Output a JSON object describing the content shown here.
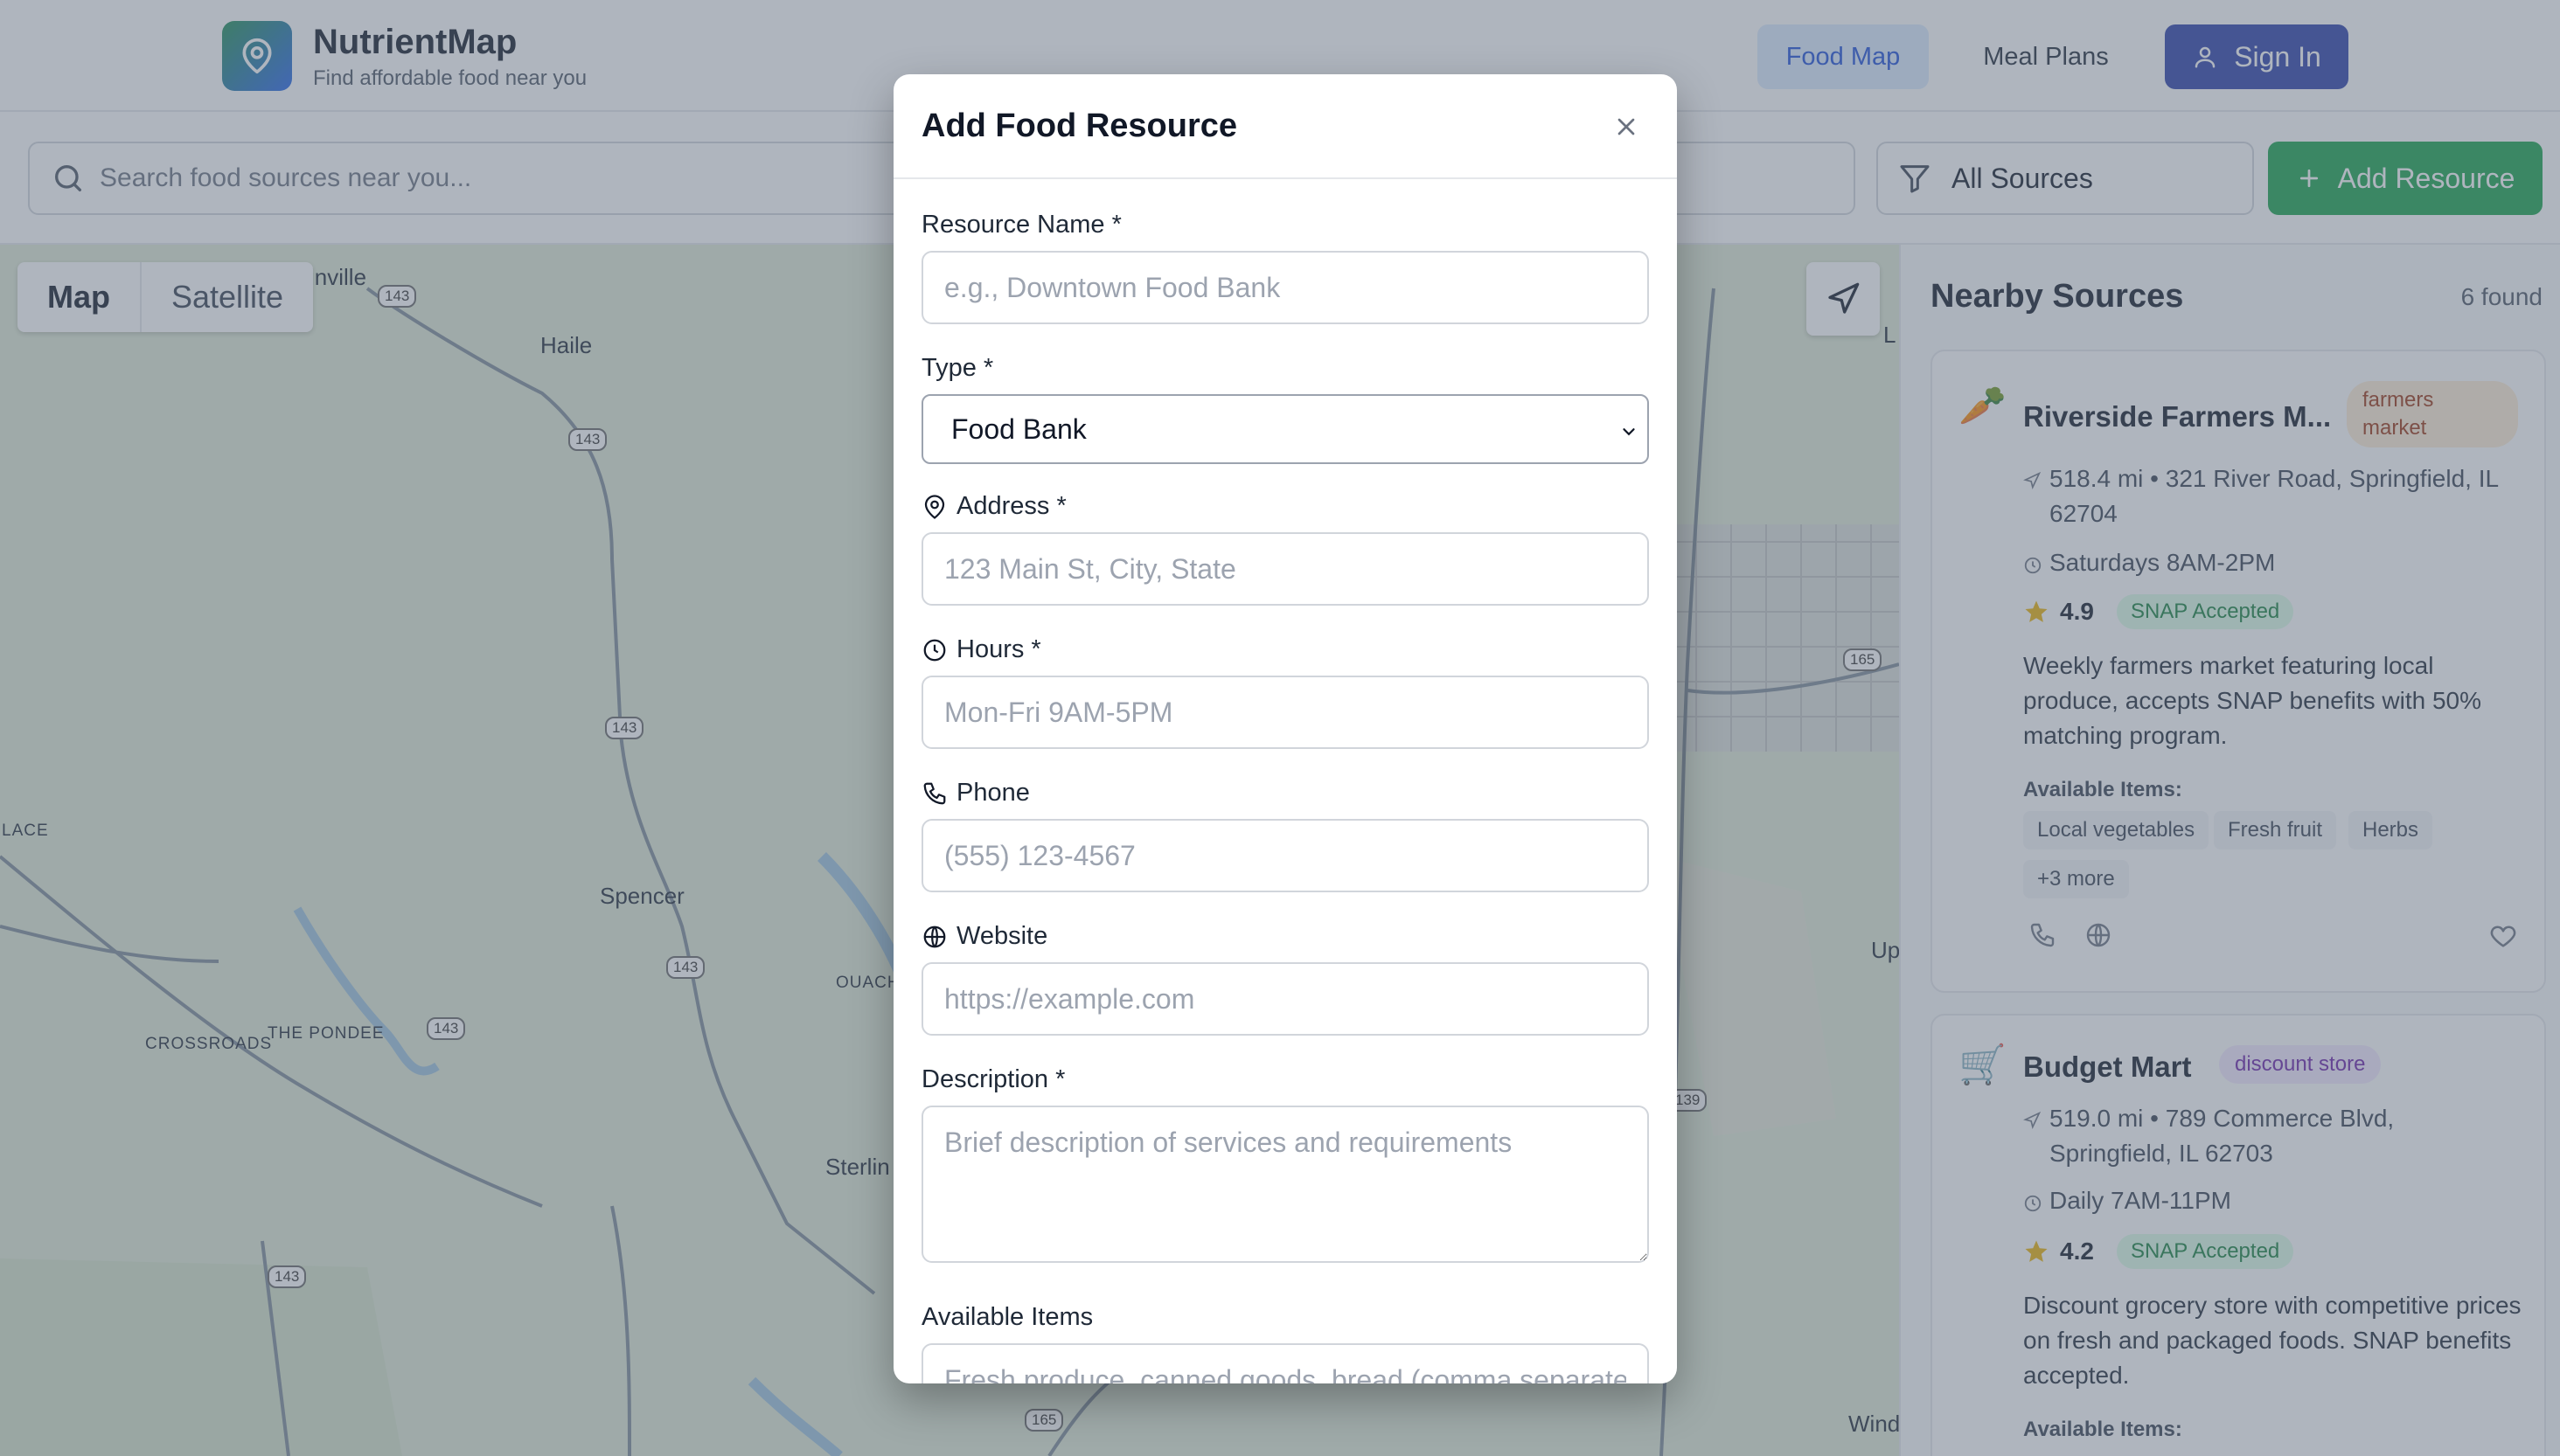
{
  "app": {
    "name": "NutrientMap",
    "tagline": "Find affordable food near you"
  },
  "nav": {
    "food_map": "Food Map",
    "meal_plans": "Meal Plans",
    "sign_in": "Sign In"
  },
  "toolbar": {
    "search_placeholder": "Search food sources near you...",
    "filter_label": "All Sources",
    "add_resource": "Add Resource"
  },
  "map": {
    "view_map": "Map",
    "view_satellite": "Satellite",
    "labels": {
      "inville": "inville",
      "haile": "Haile",
      "spencer": "Spencer",
      "sterlin": "Sterlin",
      "lace": "LACE",
      "ouach": "OUACH",
      "crossroads": "CROSSROADS",
      "the_pondee": "THE PONDEE",
      "up": "Up",
      "wind": "Wind",
      "l": "L"
    },
    "shields": {
      "r143a": "143",
      "r143b": "143",
      "r143c": "143",
      "r143d": "143",
      "r143e": "143",
      "r143f": "143",
      "r165a": "165",
      "r165b": "165",
      "r139": "139",
      "ouac": "Ouac"
    }
  },
  "sidebar": {
    "title": "Nearby Sources",
    "count": "6 found",
    "available_label": "Available Items:",
    "cards": [
      {
        "emoji": "🥕",
        "name": "Riverside Farmers M...",
        "badge": "farmers market",
        "distance_address": "518.4 mi • 321 River Road, Springfield, IL 62704",
        "hours": "Saturdays 8AM-2PM",
        "rating": "4.9",
        "snap": "SNAP Accepted",
        "description": "Weekly farmers market featuring local produce, accepts SNAP benefits with 50% matching program.",
        "items": [
          "Local vegetables",
          "Fresh fruit",
          "Herbs",
          "+3 more"
        ]
      },
      {
        "emoji": "🛒",
        "name": "Budget Mart",
        "badge": "discount store",
        "distance_address": "519.0 mi • 789 Commerce Blvd, Springfield, IL 62703",
        "hours": "Daily 7AM-11PM",
        "rating": "4.2",
        "snap": "SNAP Accepted",
        "description": "Discount grocery store with competitive prices on fresh and packaged foods. SNAP benefits accepted."
      }
    ]
  },
  "modal": {
    "title": "Add Food Resource",
    "fields": {
      "name_label": "Resource Name *",
      "name_placeholder": "e.g., Downtown Food Bank",
      "type_label": "Type *",
      "type_value": "Food Bank",
      "address_label": "Address *",
      "address_placeholder": "123 Main St, City, State",
      "hours_label": "Hours *",
      "hours_placeholder": "Mon-Fri 9AM-5PM",
      "phone_label": "Phone",
      "phone_placeholder": "(555) 123-4567",
      "website_label": "Website",
      "website_placeholder": "https://example.com",
      "description_label": "Description *",
      "description_placeholder": "Brief description of services and requirements",
      "items_label": "Available Items",
      "items_placeholder": "Fresh produce, canned goods, bread (comma separated)"
    }
  },
  "colors": {
    "brand_blue": "#2a3ea8",
    "brand_green": "#16a34a",
    "snap_green": "#15803d",
    "overlay": "rgba(95,108,125,0.5)"
  }
}
